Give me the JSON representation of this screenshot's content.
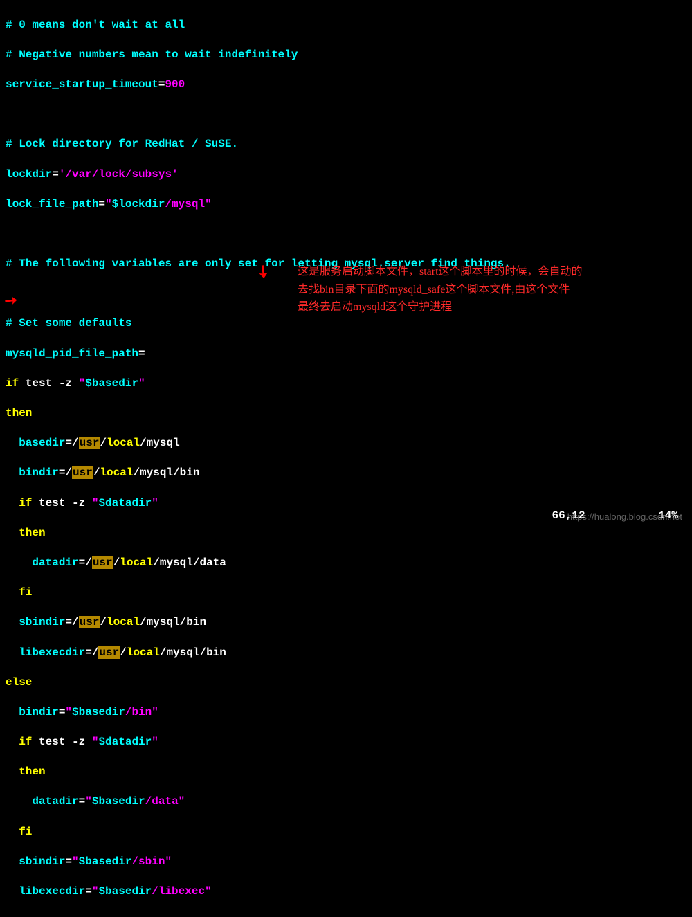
{
  "code": {
    "c1": "# 0 means don't wait at all",
    "c2": "# Negative numbers mean to wait indefinitely",
    "l3a": "service_startup_timeout",
    "l3b": "=",
    "l3c": "900",
    "c4": "# Lock directory for RedHat / SuSE.",
    "l5a": "lockdir",
    "l5b": "=",
    "l5c": "'/var/lock/subsys'",
    "l6a": "lock_file_path",
    "l6b": "=",
    "l6c": "\"",
    "l6d": "$lockdir",
    "l6e": "/mysql",
    "l6f": "\"",
    "c7": "# The following variables are only set for letting mysql.server find things.",
    "c8": "# Set some defaults",
    "l9a": "mysqld_pid_file_path",
    "l9b": "=",
    "l10a": "if",
    "l10b": " test -z ",
    "l10c": "\"",
    "l10d": "$basedir",
    "l10e": "\"",
    "l11": "then",
    "l12a": "  basedir",
    "l12b": "=/",
    "l12usr": "usr",
    "l12c": "/",
    "l12d": "local",
    "l12e": "/mysql",
    "l13a": "  bindir",
    "l13b": "=/",
    "l13c": "/",
    "l13d": "local",
    "l13e": "/mysql/bin",
    "l14a": "  if",
    "l14b": " test -z ",
    "l14c": "\"",
    "l14d": "$datadir",
    "l14e": "\"",
    "l15": "  then",
    "l16a": "    datadir",
    "l16b": "=/",
    "l16c": "/",
    "l16d": "local",
    "l16e": "/mysql/data",
    "l17": "  fi",
    "l18a": "  sbindir",
    "l18b": "=/",
    "l18c": "/",
    "l18d": "local",
    "l18e": "/mysql/bin",
    "l19a": "  libexecdir",
    "l19b": "=/",
    "l19c": "/",
    "l19d": "local",
    "l19e": "/mysql/bin",
    "l20": "else",
    "l21a": "  bindir",
    "l21b": "=",
    "l21c": "\"",
    "l21d": "$basedir",
    "l21e": "/bin",
    "l21f": "\"",
    "l22a": "  if",
    "l22b": " test -z ",
    "l22c": "\"",
    "l22d": "$datadir",
    "l22e": "\"",
    "l23": "  then",
    "l24a": "    datadir",
    "l24b": "=",
    "l24c": "\"",
    "l24d": "$basedir",
    "l24e": "/data",
    "l24f": "\"",
    "l25": "  fi",
    "l26a": "  sbindir",
    "l26b": "=",
    "l26c": "\"",
    "l26d": "$basedir",
    "l26e": "/sbin",
    "l26f": "\"",
    "l27a": "  libexecdir",
    "l27b": "=",
    "l27c": "\"",
    "l27d": "$basedir",
    "l27e": "/libexec",
    "l27f": "\""
  },
  "annotation": {
    "line1": "这是服务启动脚本文件，start这个脚本里的时候，会自动的",
    "line2": "去找bin目录下面的mysqld_safe这个脚本文件,由这个文件",
    "line3": "最终去启动mysqld这个守护进程"
  },
  "status": {
    "pos": "66,12",
    "pct": "14%"
  },
  "watermark": "https://hualong.blog.csdn.net"
}
